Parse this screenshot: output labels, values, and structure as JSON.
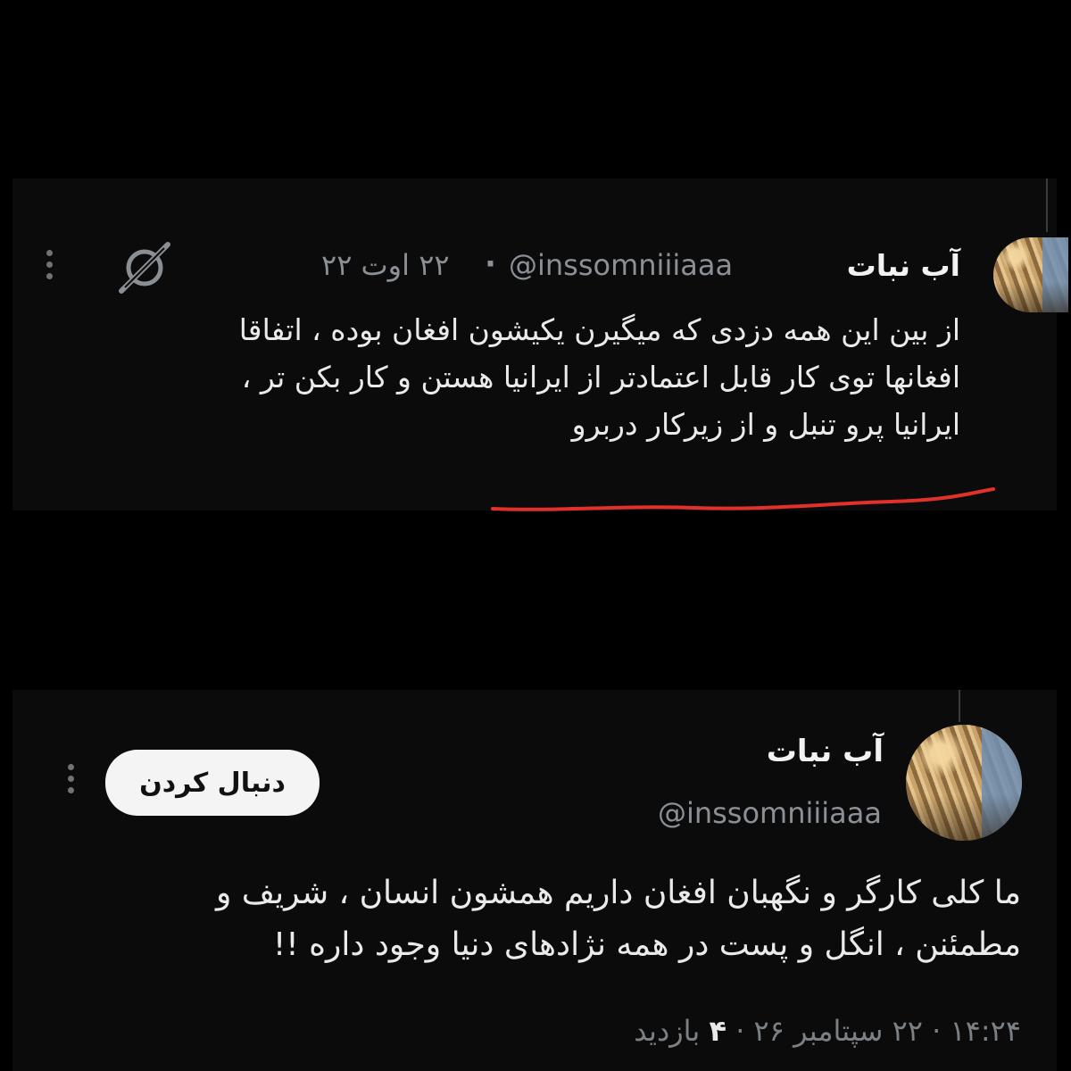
{
  "tweet1": {
    "display_name": "آب نبات",
    "handle": "@inssomniiiaaa",
    "date": "۲۲ اوت ۲۲",
    "dot": "·",
    "lines": [
      "از بین این همه دزدی که میگیرن یکیشون افغان بوده ، اتفاقا",
      "افغانها توی کار قابل اعتمادتر از ایرانیا هستن و کار بکن تر ،",
      "ایرانیا پرو تنبل و از زیرکار دربرو"
    ],
    "underline_color": "#e0312b",
    "icons": [
      "grok-icon",
      "more-options-icon"
    ]
  },
  "tweet2": {
    "display_name": "آب نبات",
    "handle": "@inssomniiiaaa",
    "follow_label": "دنبال کردن",
    "lines": [
      "ما کلی کارگر و نگهبان افغان داریم همشون انسان ، شریف و",
      "مطمئنن ، انگل و پست در همه نژادهای دنیا وجود داره !!"
    ],
    "time": "۱۴:۲۴",
    "date": "۲۲ سپتامبر ۲۶",
    "views_count": "۴",
    "views_label": "بازدید",
    "dot": "·",
    "icons": [
      "more-options-icon"
    ]
  }
}
